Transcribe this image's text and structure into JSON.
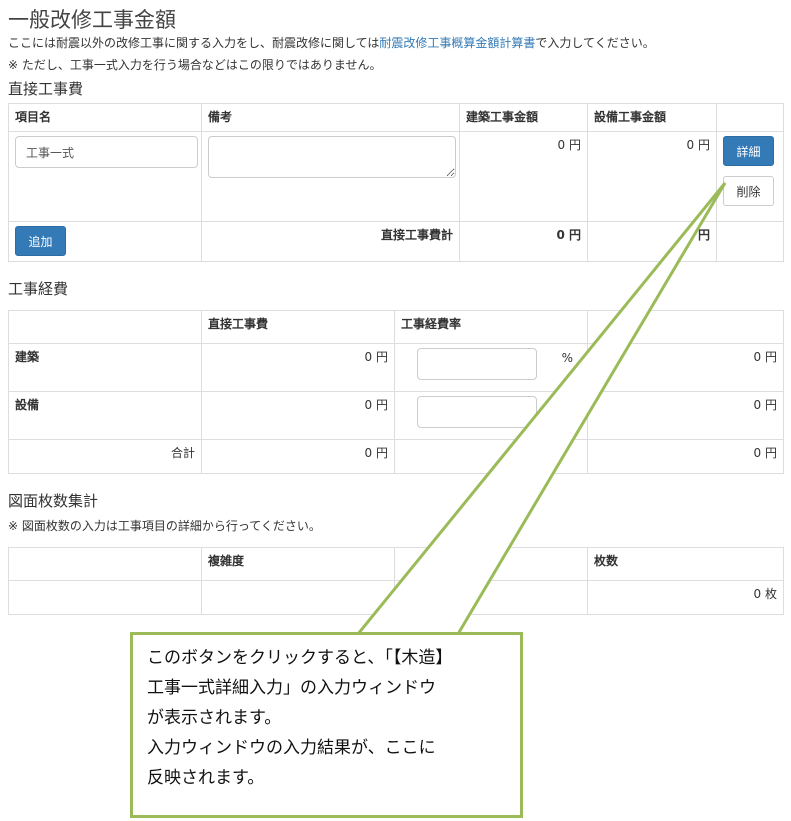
{
  "page": {
    "title": "一般改修工事金額",
    "note1_before": "ここには耐震以外の改修工事に関する入力をし、耐震改修に関しては",
    "note1_link": "耐震改修工事概算金額計算書",
    "note1_after": "で入力してください。",
    "note2": "※ ただし、工事一式入力を行う場合などはこの限りではありません。"
  },
  "direct": {
    "heading": "直接工事費",
    "headers": [
      "項目名",
      "備考",
      "建築工事金額",
      "設備工事金額",
      ""
    ],
    "row": {
      "item_value": "工事一式",
      "remarks_value": "",
      "building_amount": "0 円",
      "equipment_amount": "0 円",
      "detail_label": "詳細",
      "delete_label": "削除"
    },
    "add_label": "追加",
    "total_label": "直接工事費計",
    "total_building": "0 円",
    "total_equipment": "0 円"
  },
  "expenses": {
    "heading": "工事経費",
    "headers": [
      "",
      "直接工事費",
      "工事経費率",
      ""
    ],
    "rows": [
      {
        "label": "建築",
        "direct": "0 円",
        "rate_value": "",
        "rate_unit": "%",
        "amount": "0 円"
      },
      {
        "label": "設備",
        "direct": "0 円",
        "rate_value": "",
        "rate_unit": "%",
        "amount": "0 円"
      }
    ],
    "total_label": "合計",
    "total_direct": "0 円",
    "total_amount": "0 円"
  },
  "drawings": {
    "heading": "図面枚数集計",
    "note": "※ 図面枚数の入力は工事項目の詳細から行ってください。",
    "headers": [
      "",
      "複雑度",
      "",
      "枚数"
    ],
    "row": {
      "count": "0 枚"
    }
  },
  "callout": {
    "lines": [
      "このボタンをクリックすると、「【木造】",
      "工事一式詳細入力」の入力ウィンドウ",
      "が表示されます。",
      "入力ウィンドウの入力結果が、ここに",
      "反映されます。"
    ],
    "color": "#9bbb59"
  }
}
